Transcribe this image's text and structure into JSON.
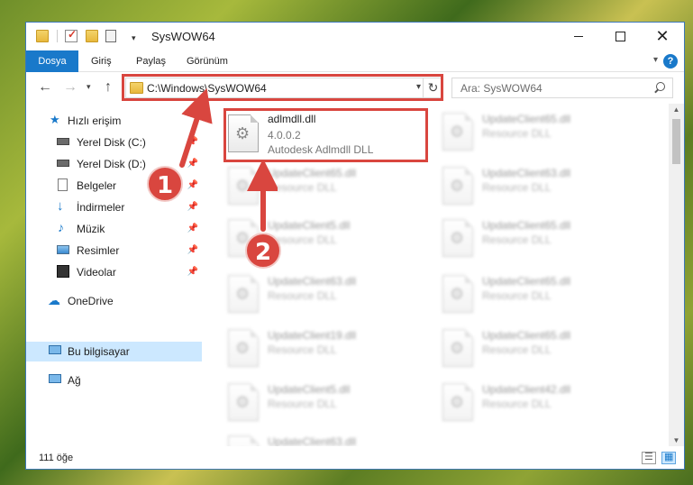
{
  "window": {
    "title": "SysWOW64"
  },
  "ribbon": {
    "tabs": [
      "Dosya",
      "Giriş",
      "Paylaş",
      "Görünüm"
    ],
    "help": "?"
  },
  "navbar": {
    "address": "C:\\Windows\\SysWOW64",
    "search_placeholder": "Ara: SysWOW64"
  },
  "sidebar": {
    "items": [
      {
        "label": "Hızlı erişim",
        "icon": "star-icon",
        "pinned": false
      },
      {
        "label": "Yerel Disk (C:)",
        "icon": "drive-icon",
        "pinned": true
      },
      {
        "label": "Yerel Disk (D:)",
        "icon": "drive-icon",
        "pinned": true
      },
      {
        "label": "Belgeler",
        "icon": "documents-icon",
        "pinned": true
      },
      {
        "label": "İndirmeler",
        "icon": "download-icon",
        "pinned": true
      },
      {
        "label": "Müzik",
        "icon": "music-icon",
        "pinned": true
      },
      {
        "label": "Resimler",
        "icon": "pictures-icon",
        "pinned": true
      },
      {
        "label": "Videolar",
        "icon": "videos-icon",
        "pinned": true
      },
      {
        "label": "OneDrive",
        "icon": "cloud-icon",
        "pinned": false
      },
      {
        "label": "Bu bilgisayar",
        "icon": "computer-icon",
        "pinned": false,
        "selected": true
      },
      {
        "label": "Ağ",
        "icon": "network-icon",
        "pinned": false
      }
    ]
  },
  "files": {
    "highlighted": {
      "name": "adlmdll.dll",
      "version": "4.0.0.2",
      "description": "Autodesk Adlmdll DLL"
    },
    "blurred": [
      {
        "name": "UpdateClient65.dll",
        "type": "Resource DLL"
      },
      {
        "name": "UpdateClient65.dll",
        "type": "Resource DLL"
      },
      {
        "name": "UpdateClient63.dll",
        "type": "Resource DLL"
      },
      {
        "name": "UpdateClient63.dll",
        "type": "Resource DLL"
      },
      {
        "name": "UpdateClient5.dll",
        "type": "Resource DLL"
      },
      {
        "name": "UpdateClient65.dll",
        "type": "Resource DLL"
      },
      {
        "name": "UpdateClient63.dll",
        "type": "Resource DLL"
      },
      {
        "name": "UpdateClient65.dll",
        "type": "Resource DLL"
      },
      {
        "name": "UpdateClient19.dll",
        "type": "Resource DLL"
      },
      {
        "name": "UpdateClient65.dll",
        "type": "Resource DLL"
      },
      {
        "name": "UpdateClient5.dll",
        "type": "Resource DLL"
      },
      {
        "name": "UpdateClient42.dll",
        "type": "Resource DLL"
      }
    ]
  },
  "status": {
    "count": "111 öğe"
  },
  "annotations": {
    "step1": "1",
    "step2": "2",
    "color": "#d9463f"
  }
}
